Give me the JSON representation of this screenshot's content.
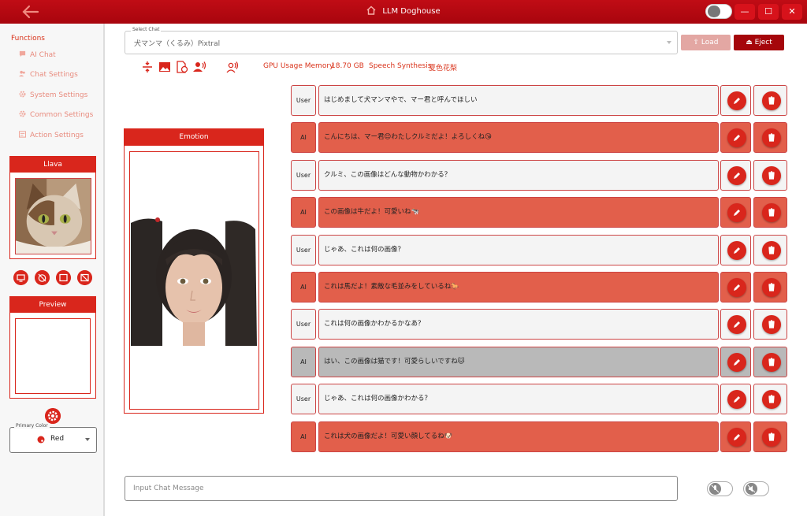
{
  "app": {
    "title": "LLM Doghouse"
  },
  "window_controls": {
    "minimize": "—",
    "maximize": "☐",
    "close": "✕"
  },
  "sidebar": {
    "functions_label": "Functions",
    "items": [
      {
        "label": "AI Chat",
        "icon": "chat-bubble-icon"
      },
      {
        "label": "Chat Settings",
        "icon": "people-icon"
      },
      {
        "label": "System Settings",
        "icon": "gear-icon"
      },
      {
        "label": "Common Settings",
        "icon": "gear-icon"
      },
      {
        "label": "Action Settings",
        "icon": "list-icon"
      }
    ],
    "llava_title": "Llava",
    "preview_title": "Preview",
    "primary_color": {
      "label": "Primary Color",
      "value": "Red"
    }
  },
  "header": {
    "select_label": "Select Chat",
    "select_value": "犬マンマ（くるみ）Pixtral",
    "load_label": "Load",
    "eject_label": "Eject",
    "gpu_label": "GPU Usage Memory",
    "gpu_value": "18.70 GB",
    "speech_label": "Speech Synthesis",
    "speech_value": "夏色花梨"
  },
  "emotion_title": "Emotion",
  "messages": [
    {
      "role": "User",
      "text": "はじめまして犬マンマやで、マー君と呼んでほしい"
    },
    {
      "role": "AI",
      "text": "こんにちは、マー君😊わたしクルミだよ！よろしくね😘"
    },
    {
      "role": "User",
      "text": "クルミ、この画像はどんな動物かわかる？"
    },
    {
      "role": "AI",
      "text": "この画像は牛だよ！可愛いね🐄"
    },
    {
      "role": "User",
      "text": "じゃあ、これは何の画像？"
    },
    {
      "role": "AI",
      "text": "これは馬だよ！素敵な毛並みをしているね🐎"
    },
    {
      "role": "User",
      "text": "これは何の画像かわかるかなあ？"
    },
    {
      "role": "AI",
      "text": "はい、この画像は猫です！可愛らしいですね🐱"
    },
    {
      "role": "User",
      "text": "じゃあ、これは何の画像かわかる？"
    },
    {
      "role": "AI",
      "text": "これは犬の画像だよ！可愛い顔してるね🐶"
    }
  ],
  "input": {
    "placeholder": "Input Chat Message"
  },
  "colors": {
    "primary": "#d9261c",
    "title_bar": "#b3070f",
    "ai_row": "#e25f4b",
    "selected_row": "#b9b9b9"
  }
}
